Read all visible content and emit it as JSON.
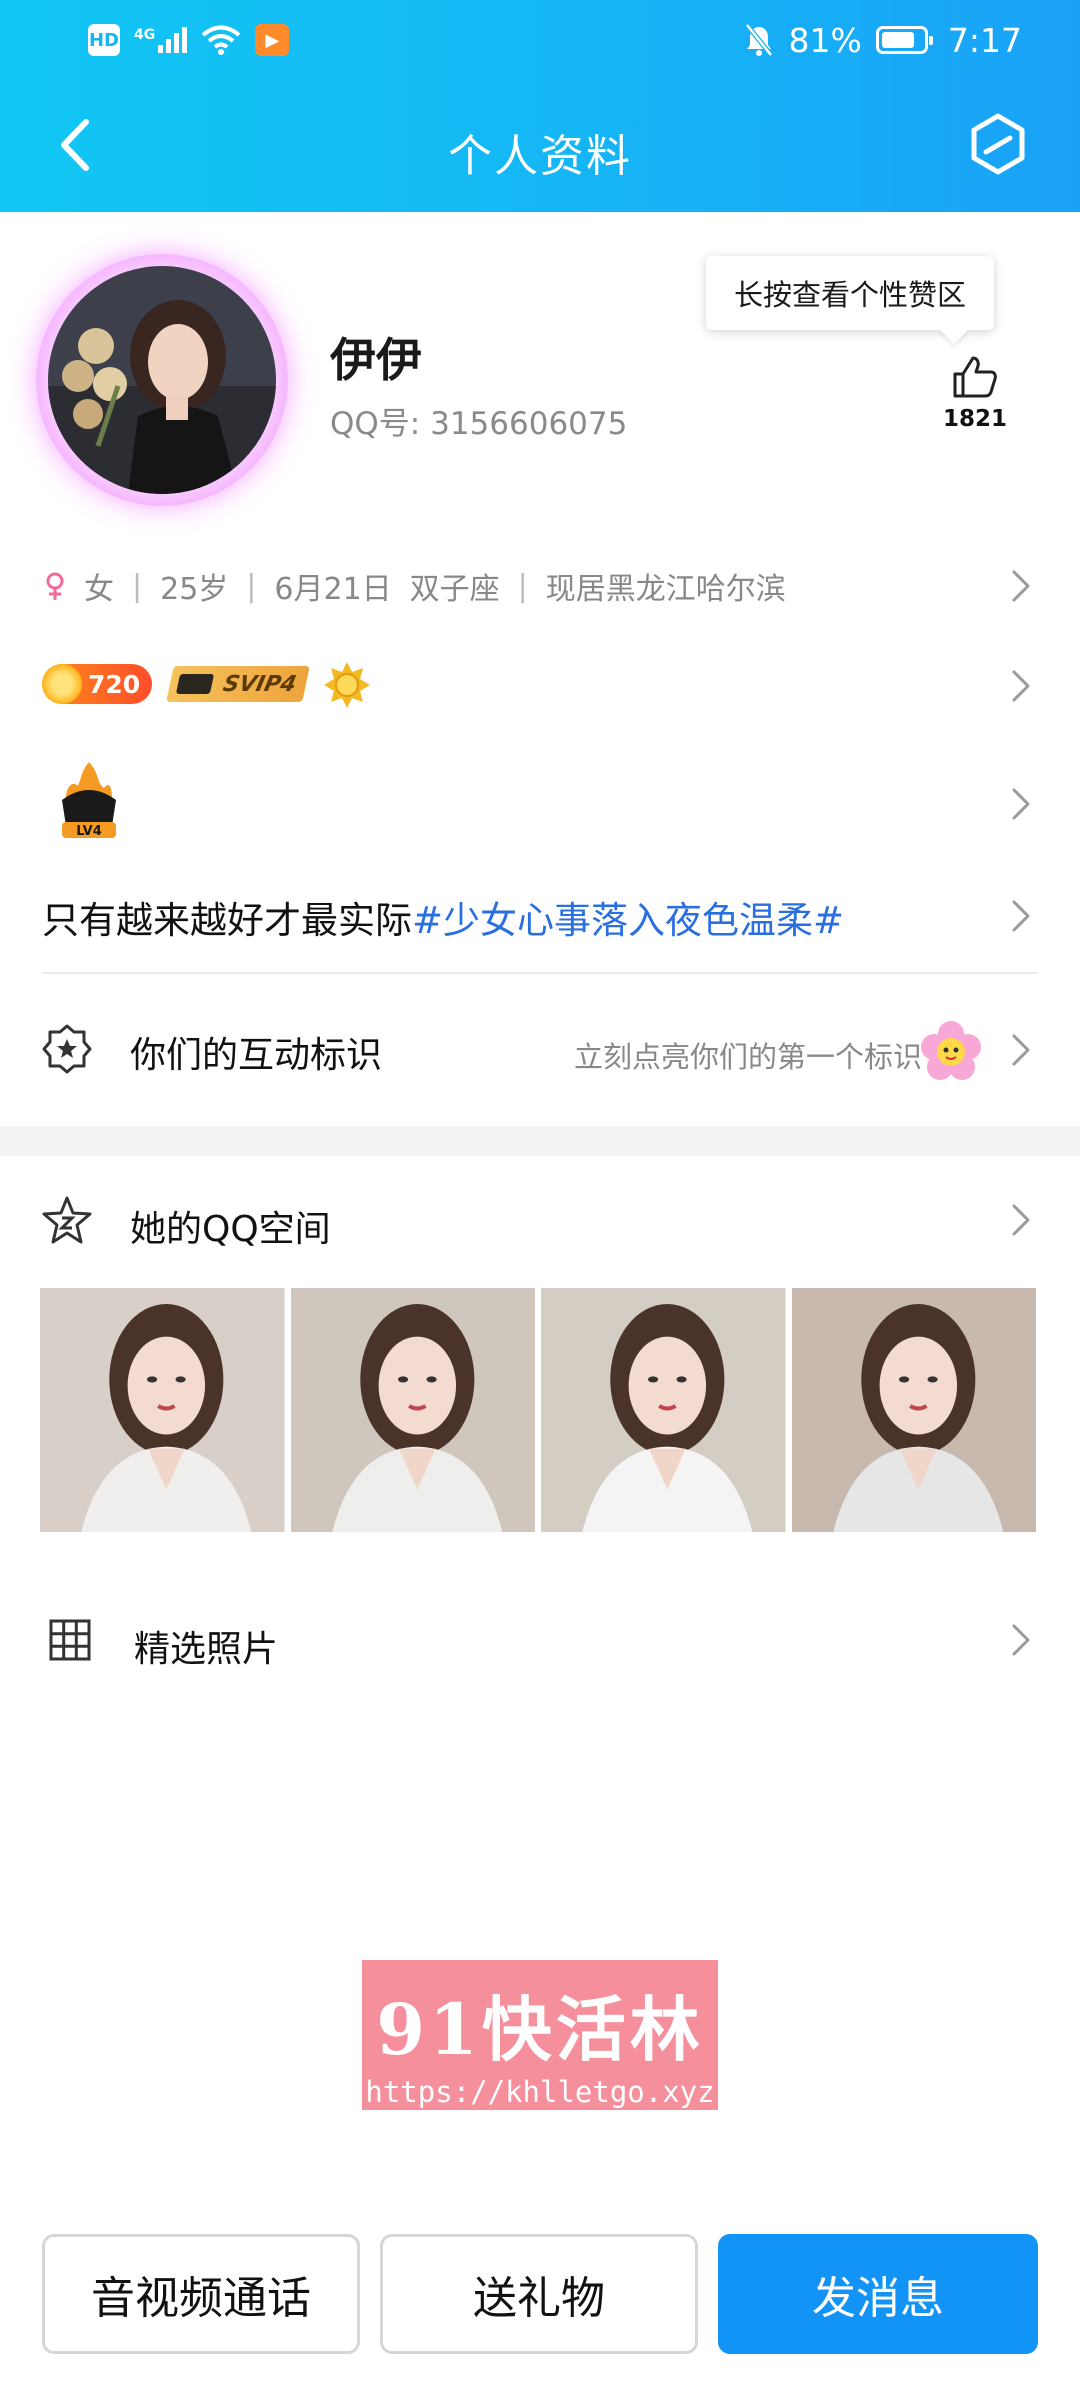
{
  "status_bar": {
    "network_label": "4G",
    "hd_label": "HD",
    "battery": "81%",
    "battery_level": 0.81,
    "time": "7:17",
    "icons": [
      "hd-icon",
      "signal-icon",
      "wifi-icon",
      "play-app-icon",
      "mute-bell-icon",
      "battery-icon"
    ]
  },
  "nav": {
    "title": "个人资料",
    "back_icon": "chevron-left-icon",
    "settings_icon": "hexagon-edit-icon"
  },
  "profile": {
    "nickname": "伊伊",
    "qq_label": "QQ号: 3156606075",
    "tooltip": "长按查看个性赞区",
    "likes": "1821"
  },
  "info": {
    "gender": "女",
    "age": "25岁",
    "birthday": "6月21日",
    "zodiac": "双子座",
    "location": "现居黑龙江哈尔滨"
  },
  "badges": {
    "coin_level": "720",
    "svip": "SVIP4"
  },
  "level": {
    "label": "LV4"
  },
  "signature": {
    "text": "只有越来越好才最实际",
    "tag": "#少女心事落入夜色温柔#"
  },
  "interaction": {
    "label": "你们的互动标识",
    "hint": "立刻点亮你们的第一个标识"
  },
  "qzone": {
    "label": "她的QQ空间",
    "photos": [
      {
        "bg": "#d8cfc8",
        "shirt": "#f1efee"
      },
      {
        "bg": "#cfc6bd",
        "shirt": "#eeeeec"
      },
      {
        "bg": "#d3cdc4",
        "shirt": "#f4f4f4"
      },
      {
        "bg": "#c8b9ae",
        "shirt": "#e6e6e6"
      }
    ]
  },
  "featured": {
    "label": "精选照片"
  },
  "watermark": {
    "title": "91快活林",
    "url": "https://khlletgo.xyz"
  },
  "actions": {
    "call": "音视频通话",
    "gift": "送礼物",
    "message": "发消息"
  },
  "colors": {
    "header_start": "#12c7f3",
    "header_end": "#1aa2f7",
    "primary_button": "#1294f6",
    "tag_blue": "#2a6fe0",
    "watermark_pink": "#f58f9c"
  }
}
